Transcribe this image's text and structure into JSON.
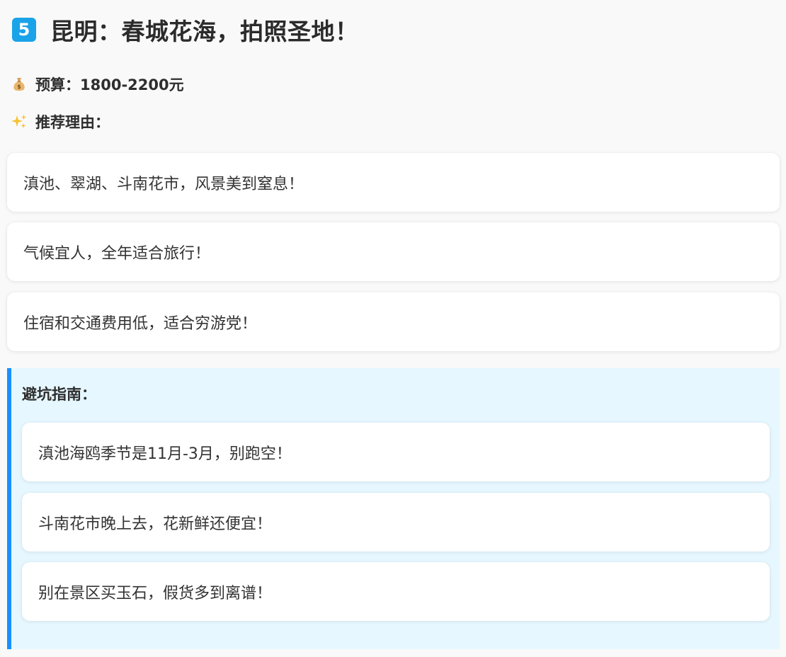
{
  "header": {
    "number_badge": "5",
    "title": "昆明：春城花海，拍照圣地！"
  },
  "budget": {
    "icon": "money-bag-icon",
    "text": "预算：1800-2200元"
  },
  "reasons": {
    "icon": "sparkles-icon",
    "heading": "推荐理由：",
    "items": [
      "滇池、翠湖、斗南花市，风景美到窒息！",
      "气候宜人，全年适合旅行！",
      "住宿和交通费用低，适合穷游党！"
    ]
  },
  "guide": {
    "heading": "避坑指南：",
    "accent_color": "#1890ff",
    "background_color": "#e6f7ff",
    "items": [
      "滇池海鸥季节是11月-3月，别跑空！",
      "斗南花市晚上去，花新鲜还便宜！",
      "别在景区买玉石，假货多到离谱！"
    ]
  },
  "colors": {
    "badge": "#1aa3e8",
    "page_background": "#f9f9f9",
    "text": "#333333"
  }
}
